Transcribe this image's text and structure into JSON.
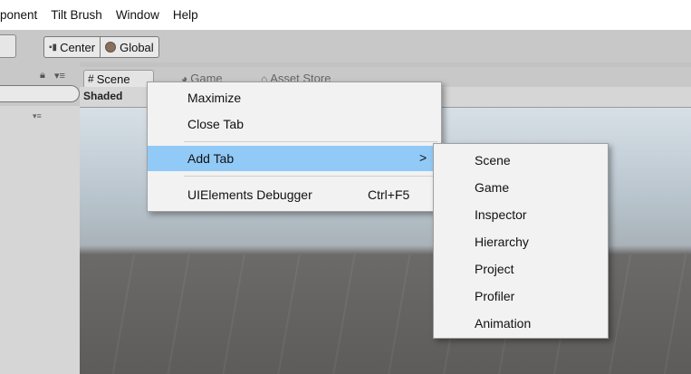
{
  "menubar": {
    "items": [
      "ponent",
      "Tilt Brush",
      "Window",
      "Help"
    ]
  },
  "toolbar": {
    "center_label": "Center",
    "global_label": "Global"
  },
  "tabs": [
    {
      "label": "Scene",
      "icon": "hash-icon"
    },
    {
      "label": "Game",
      "icon": "pacman-icon"
    },
    {
      "label": "Asset Store",
      "icon": "store-icon"
    }
  ],
  "scene_toolbar": {
    "shading_mode": "Shaded"
  },
  "context_menu": {
    "items": [
      {
        "label": "Maximize"
      },
      {
        "label": "Close Tab"
      },
      {
        "label": "Add Tab",
        "submenu_arrow": ">"
      },
      {
        "label": "UIElements Debugger",
        "shortcut": "Ctrl+F5"
      }
    ]
  },
  "add_tab_submenu": {
    "items": [
      "Scene",
      "Game",
      "Inspector",
      "Hierarchy",
      "Project",
      "Profiler",
      "Animation"
    ]
  },
  "colors": {
    "highlight": "#91c9f7",
    "menu_bg": "#f2f2f2"
  }
}
